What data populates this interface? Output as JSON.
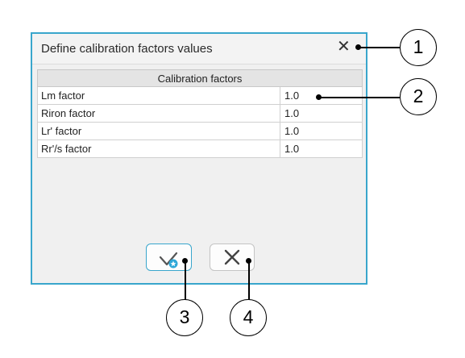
{
  "dialog": {
    "title": "Define calibration factors values",
    "close_glyph": "✕",
    "table": {
      "header": "Calibration factors",
      "rows": [
        {
          "name": "Lm factor",
          "value": "1.0"
        },
        {
          "name": "Riron factor",
          "value": "1.0"
        },
        {
          "name": "Lr' factor",
          "value": "1.0"
        },
        {
          "name": "Rr'/s factor",
          "value": "1.0"
        }
      ]
    },
    "buttons": {
      "ok_icon": "checkmark-icon",
      "cancel_icon": "close-icon"
    }
  },
  "callouts": [
    "1",
    "2",
    "3",
    "4"
  ],
  "colors": {
    "accent": "#39a6cc",
    "dialog_bg": "#f0f0f0",
    "header_bg": "#e4e4e4"
  }
}
